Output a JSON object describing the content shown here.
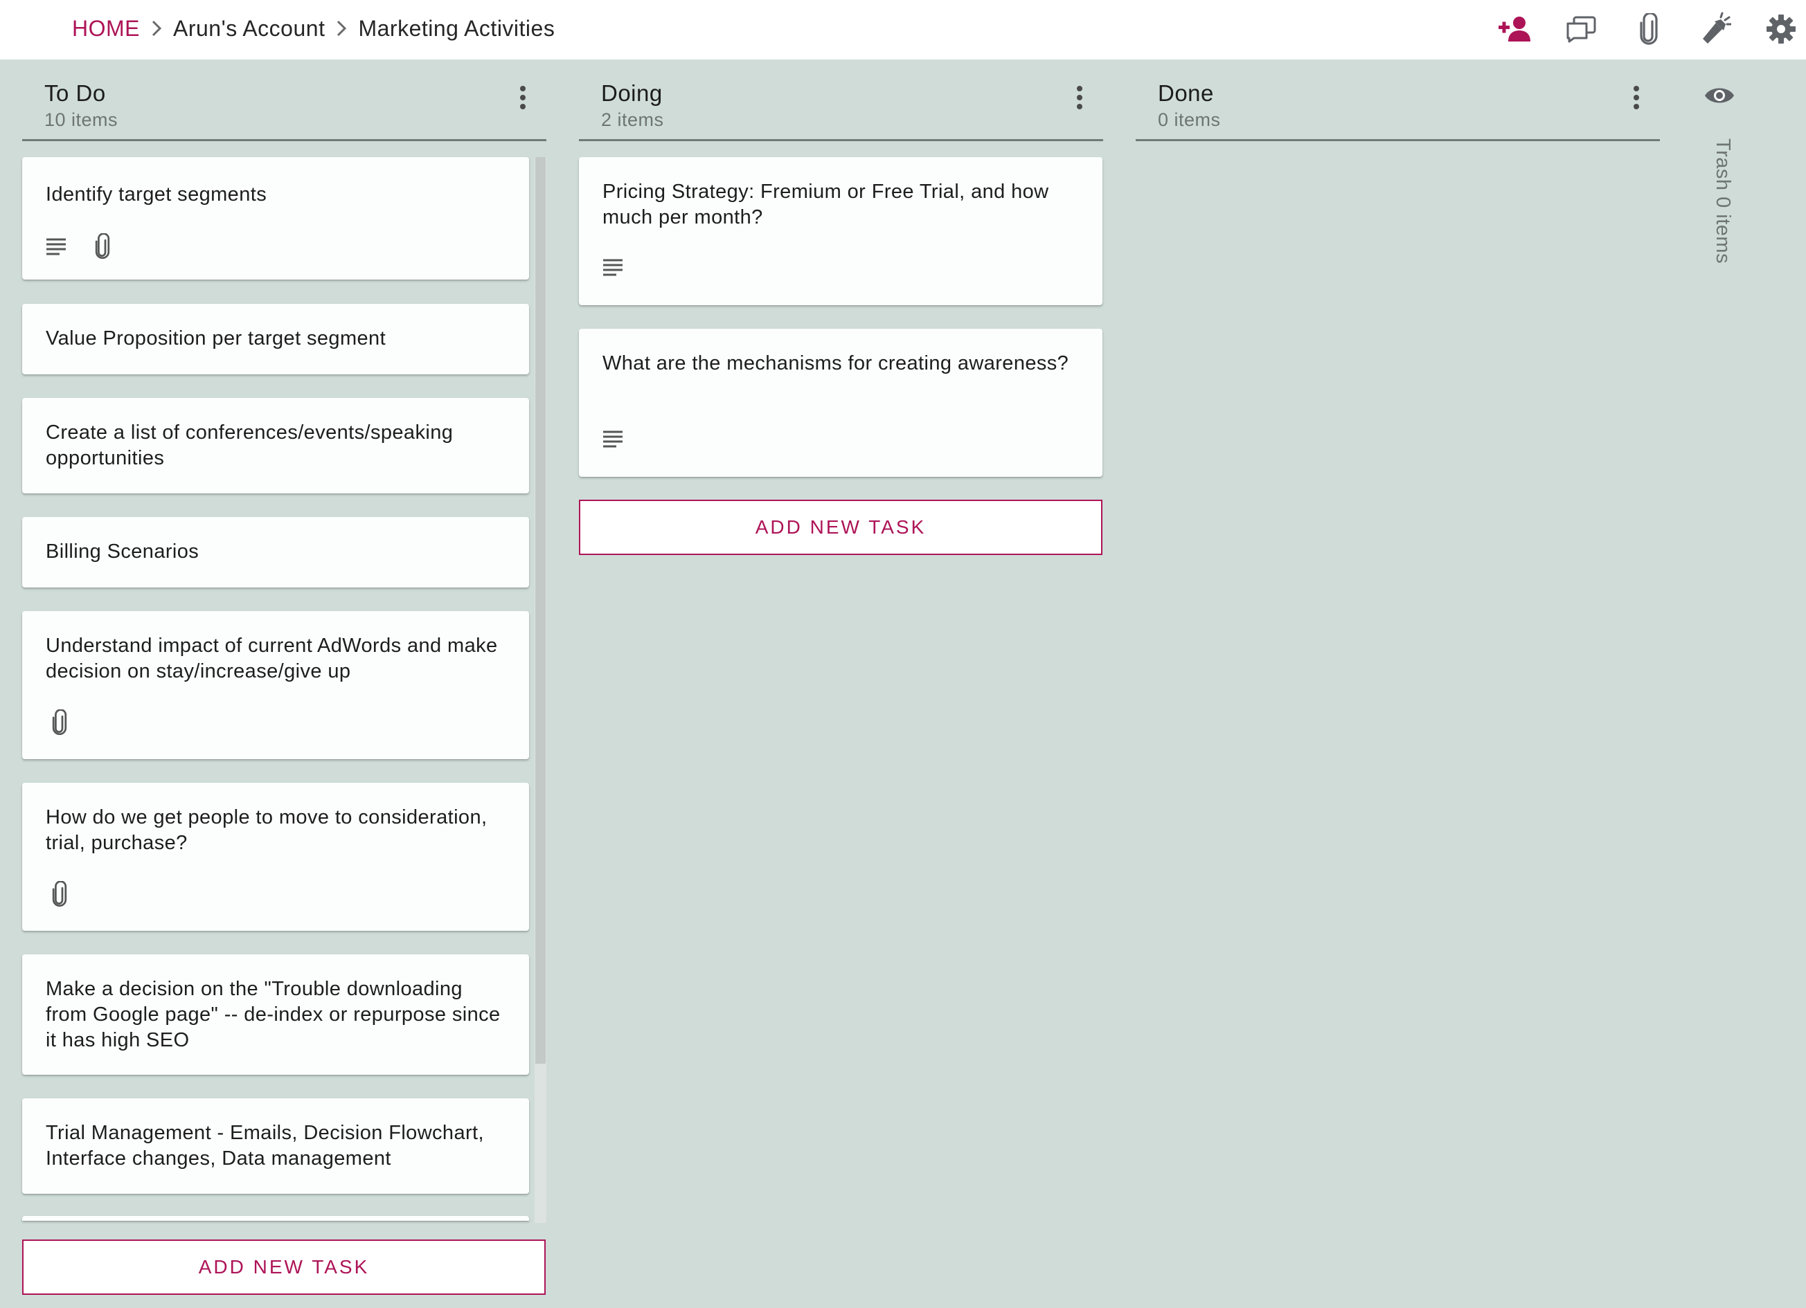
{
  "breadcrumb": {
    "home": "HOME",
    "account": "Arun's Account",
    "board": "Marketing Activities"
  },
  "toolbar": {
    "icons": [
      "add-member-icon",
      "comments-icon",
      "attachment-icon",
      "flashlight-icon",
      "settings-icon"
    ]
  },
  "columns": [
    {
      "title": "To Do",
      "count": "10 items",
      "cards": [
        {
          "title": "Identify target segments",
          "icons": [
            "description",
            "attachment"
          ]
        },
        {
          "title": "Value Proposition per target segment",
          "icons": []
        },
        {
          "title": "Create a list of conferences/events/speaking opportunities",
          "icons": []
        },
        {
          "title": "Billing Scenarios",
          "icons": []
        },
        {
          "title": "Understand impact of current AdWords and make decision on stay/increase/give up",
          "icons": [
            "attachment"
          ]
        },
        {
          "title": "How do we get people to move to consideration, trial, purchase?",
          "icons": [
            "attachment"
          ]
        },
        {
          "title": "Make a decision on the \"Trouble downloading from Google page\" -- de-index or repurpose since it has high SEO",
          "icons": []
        },
        {
          "title": "Trial Management - Emails, Decision Flowchart, Interface changes, Data management",
          "icons": []
        }
      ],
      "add_label": "ADD NEW TASK"
    },
    {
      "title": "Doing",
      "count": "2 items",
      "cards": [
        {
          "title": "Pricing Strategy: Fremium or Free Trial, and how much per month?",
          "icons": [
            "description"
          ]
        },
        {
          "title": "What are the mechanisms for creating awareness?",
          "icons": [
            "description"
          ]
        }
      ],
      "add_label": "ADD NEW TASK"
    },
    {
      "title": "Done",
      "count": "0 items",
      "cards": []
    }
  ],
  "trash": {
    "label": "Trash 0 items"
  },
  "colors": {
    "accent": "#ad1457",
    "background": "#cfdcd8",
    "card": "#fcfdfd"
  }
}
